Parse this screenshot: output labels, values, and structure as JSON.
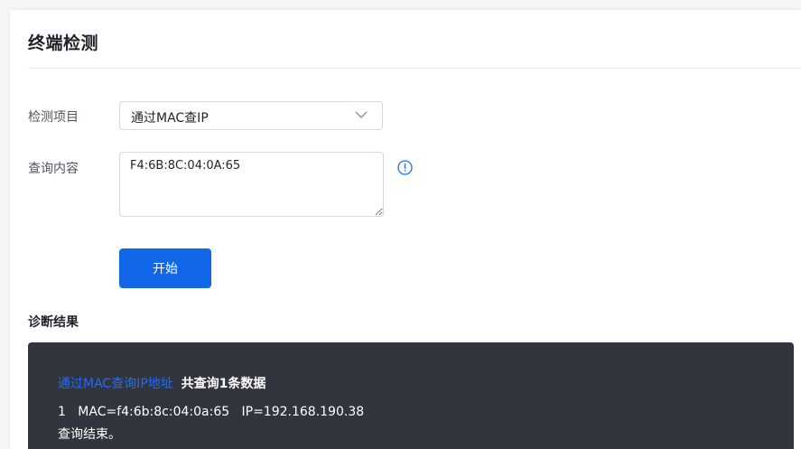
{
  "page": {
    "title": "终端检测"
  },
  "form": {
    "item_label": "检测项目",
    "item_value": "通过MAC查IP",
    "content_label": "查询内容",
    "content_value": "F4:6B:8C:04:0A:65",
    "start_label": "开始"
  },
  "result": {
    "heading": "诊断结果",
    "mode_label": "通过MAC查询IP地址",
    "summary": "共查询1条数据",
    "row_index": "1",
    "row_mac": "MAC=f4:6b:8c:04:0a:65",
    "row_ip": "IP=192.168.190.38",
    "end_text": "查询结束。"
  },
  "icons": {
    "select_arrow": "chevron-down-icon",
    "help": "info-icon"
  },
  "colors": {
    "primary": "#1167e8",
    "link": "#1f6bff",
    "result_background": "#31353d",
    "info_icon": "#1f6bff"
  }
}
